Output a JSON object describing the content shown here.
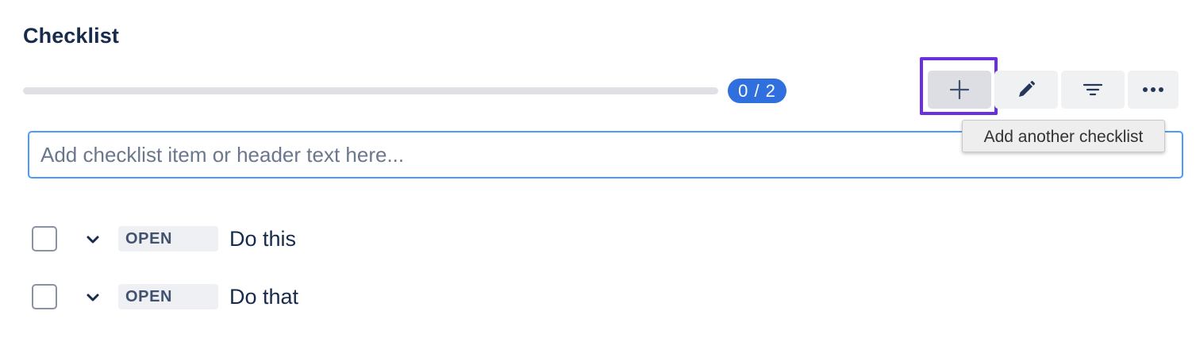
{
  "checklist": {
    "title": "Checklist",
    "progress": {
      "completed": 0,
      "total": 2,
      "label": "0 / 2",
      "fill_fraction": 0,
      "fill_color": "#36b37e",
      "badge_color": "#2f6fde"
    },
    "toolbar": {
      "add_icon": "plus-icon",
      "edit_icon": "pencil-icon",
      "filter_icon": "filter-icon",
      "more_icon": "more-horizontal-icon",
      "highlight_color": "#6a2fe0"
    },
    "tooltip": "Add another checklist",
    "input": {
      "placeholder": "Add checklist item or header text here...",
      "value": ""
    },
    "items": [
      {
        "status": "OPEN",
        "text": "Do this",
        "checked": false
      },
      {
        "status": "OPEN",
        "text": "Do that",
        "checked": false
      }
    ]
  }
}
